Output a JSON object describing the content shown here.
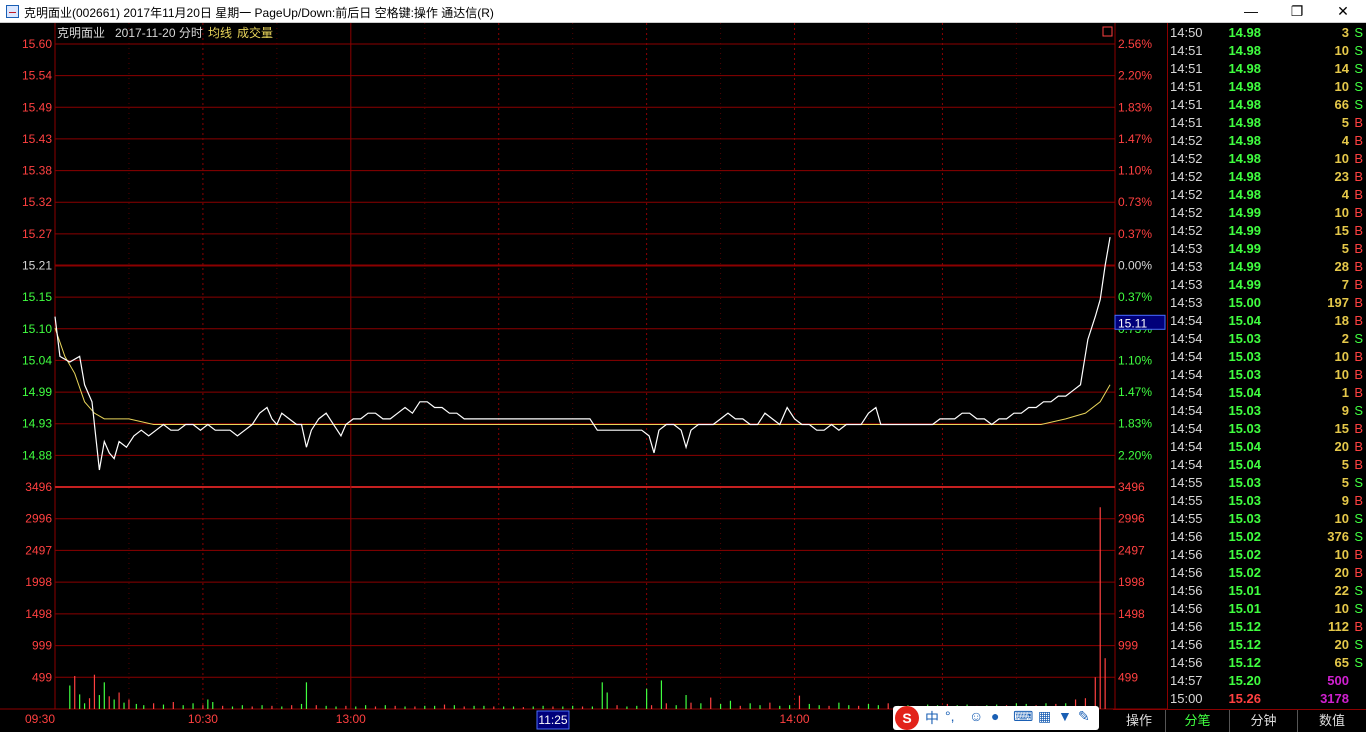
{
  "window": {
    "title": "克明面业(002661) 2017年11月20日 星期一 PageUp/Down:前后日 空格键:操作 通达信(R)",
    "minimize": "—",
    "restore": "❐",
    "close": "✕"
  },
  "chart_header": {
    "name": "克明面业",
    "date_mode": "2017-11-20 分时",
    "avg_label": "均线",
    "vol_label": "成交量",
    "corner_icon": "square-icon"
  },
  "cursor_price": "15.11",
  "cursor_time": "11:25",
  "colors": {
    "up": "#ff4040",
    "down": "#40ff40",
    "grid": "#8b0000",
    "price": "#ffffff",
    "avg": "#e8d45a",
    "volume_b": "#ff4040",
    "volume_s": "#40ff40"
  },
  "chart_data": {
    "type": "line",
    "title": "",
    "prev_close": 15.21,
    "price_axis": [
      "15.60",
      "15.54",
      "15.49",
      "15.43",
      "15.38",
      "15.32",
      "15.27",
      "15.21",
      "15.15",
      "15.10",
      "15.04",
      "14.99",
      "14.93",
      "14.88"
    ],
    "pct_axis": [
      "2.56%",
      "2.20%",
      "1.83%",
      "1.47%",
      "1.10%",
      "0.73%",
      "0.37%",
      "0.00%",
      "0.37%",
      "0.73%",
      "1.10%",
      "1.47%",
      "1.83%",
      "2.20%"
    ],
    "volume_axis": [
      "3496",
      "2996",
      "2497",
      "1998",
      "1498",
      "999",
      "499"
    ],
    "time_axis": [
      "09:30",
      "10:30",
      "13:00",
      "14:00"
    ],
    "ylim": [
      14.82,
      15.6
    ],
    "price_series": [
      [
        0,
        15.12
      ],
      [
        2,
        15.05
      ],
      [
        6,
        15.04
      ],
      [
        10,
        15.05
      ],
      [
        12,
        15.0
      ],
      [
        15,
        14.97
      ],
      [
        18,
        14.85
      ],
      [
        20,
        14.9
      ],
      [
        22,
        14.88
      ],
      [
        24,
        14.87
      ],
      [
        26,
        14.9
      ],
      [
        29,
        14.89
      ],
      [
        32,
        14.91
      ],
      [
        35,
        14.92
      ],
      [
        38,
        14.91
      ],
      [
        41,
        14.92
      ],
      [
        44,
        14.93
      ],
      [
        47,
        14.92
      ],
      [
        50,
        14.92
      ],
      [
        53,
        14.93
      ],
      [
        56,
        14.93
      ],
      [
        59,
        14.92
      ],
      [
        62,
        14.93
      ],
      [
        65,
        14.92
      ],
      [
        68,
        14.92
      ],
      [
        71,
        14.92
      ],
      [
        74,
        14.91
      ],
      [
        77,
        14.92
      ],
      [
        80,
        14.93
      ],
      [
        83,
        14.95
      ],
      [
        86,
        14.96
      ],
      [
        88,
        14.94
      ],
      [
        90,
        14.93
      ],
      [
        92,
        14.95
      ],
      [
        95,
        14.94
      ],
      [
        98,
        14.93
      ],
      [
        100,
        14.93
      ],
      [
        102,
        14.89
      ],
      [
        104,
        14.92
      ],
      [
        107,
        14.94
      ],
      [
        110,
        14.95
      ],
      [
        113,
        14.93
      ],
      [
        116,
        14.91
      ],
      [
        118,
        14.93
      ],
      [
        121,
        14.94
      ],
      [
        124,
        14.94
      ],
      [
        127,
        14.95
      ],
      [
        130,
        14.95
      ],
      [
        133,
        14.94
      ],
      [
        136,
        14.94
      ],
      [
        139,
        14.95
      ],
      [
        142,
        14.96
      ],
      [
        145,
        14.95
      ],
      [
        148,
        14.97
      ],
      [
        151,
        14.97
      ],
      [
        154,
        14.96
      ],
      [
        157,
        14.96
      ],
      [
        160,
        14.95
      ],
      [
        163,
        14.95
      ],
      [
        166,
        14.94
      ],
      [
        169,
        14.94
      ],
      [
        172,
        14.94
      ],
      [
        175,
        14.94
      ],
      [
        178,
        14.94
      ],
      [
        181,
        14.94
      ],
      [
        184,
        14.94
      ],
      [
        187,
        14.94
      ],
      [
        190,
        14.94
      ],
      [
        193,
        14.94
      ],
      [
        196,
        14.94
      ],
      [
        199,
        14.94
      ],
      [
        202,
        14.94
      ],
      [
        205,
        14.94
      ],
      [
        208,
        14.94
      ],
      [
        211,
        14.94
      ],
      [
        214,
        14.94
      ],
      [
        217,
        14.94
      ],
      [
        220,
        14.92
      ],
      [
        223,
        14.92
      ],
      [
        226,
        14.92
      ],
      [
        229,
        14.92
      ],
      [
        232,
        14.92
      ],
      [
        235,
        14.92
      ],
      [
        238,
        14.92
      ],
      [
        241,
        14.91
      ],
      [
        243,
        14.88
      ],
      [
        245,
        14.92
      ],
      [
        248,
        14.93
      ],
      [
        251,
        14.93
      ],
      [
        254,
        14.92
      ],
      [
        256,
        14.89
      ],
      [
        258,
        14.92
      ],
      [
        261,
        14.93
      ],
      [
        264,
        14.93
      ],
      [
        267,
        14.93
      ],
      [
        270,
        14.94
      ],
      [
        273,
        14.95
      ],
      [
        276,
        14.94
      ],
      [
        279,
        14.94
      ],
      [
        282,
        14.93
      ],
      [
        285,
        14.93
      ],
      [
        288,
        14.95
      ],
      [
        291,
        14.94
      ],
      [
        294,
        14.93
      ],
      [
        297,
        14.96
      ],
      [
        300,
        14.94
      ],
      [
        303,
        14.93
      ],
      [
        306,
        14.93
      ],
      [
        309,
        14.92
      ],
      [
        312,
        14.92
      ],
      [
        315,
        14.93
      ],
      [
        318,
        14.92
      ],
      [
        321,
        14.93
      ],
      [
        324,
        14.93
      ],
      [
        327,
        14.93
      ],
      [
        330,
        14.95
      ],
      [
        333,
        14.96
      ],
      [
        335,
        14.93
      ],
      [
        338,
        14.93
      ],
      [
        341,
        14.93
      ],
      [
        344,
        14.93
      ],
      [
        347,
        14.93
      ],
      [
        350,
        14.93
      ],
      [
        353,
        14.93
      ],
      [
        356,
        14.93
      ],
      [
        359,
        14.94
      ],
      [
        362,
        14.94
      ],
      [
        365,
        14.94
      ],
      [
        368,
        14.95
      ],
      [
        371,
        14.95
      ],
      [
        374,
        14.94
      ],
      [
        377,
        14.94
      ],
      [
        380,
        14.93
      ],
      [
        383,
        14.94
      ],
      [
        386,
        14.94
      ],
      [
        389,
        14.95
      ],
      [
        392,
        14.95
      ],
      [
        395,
        14.96
      ],
      [
        398,
        14.96
      ],
      [
        401,
        14.97
      ],
      [
        404,
        14.97
      ],
      [
        407,
        14.98
      ],
      [
        410,
        14.98
      ],
      [
        413,
        14.99
      ],
      [
        416,
        15.0
      ],
      [
        419,
        15.08
      ],
      [
        422,
        15.12
      ],
      [
        424,
        15.15
      ],
      [
        426,
        15.21
      ],
      [
        428,
        15.26
      ]
    ],
    "avg_series": [
      [
        0,
        15.1
      ],
      [
        4,
        15.05
      ],
      [
        8,
        15.02
      ],
      [
        12,
        14.97
      ],
      [
        16,
        14.95
      ],
      [
        20,
        14.94
      ],
      [
        30,
        14.94
      ],
      [
        40,
        14.93
      ],
      [
        60,
        14.93
      ],
      [
        80,
        14.93
      ],
      [
        100,
        14.93
      ],
      [
        120,
        14.93
      ],
      [
        140,
        14.93
      ],
      [
        160,
        14.93
      ],
      [
        180,
        14.93
      ],
      [
        200,
        14.93
      ],
      [
        220,
        14.93
      ],
      [
        240,
        14.93
      ],
      [
        260,
        14.93
      ],
      [
        280,
        14.93
      ],
      [
        300,
        14.93
      ],
      [
        320,
        14.93
      ],
      [
        340,
        14.93
      ],
      [
        360,
        14.93
      ],
      [
        380,
        14.93
      ],
      [
        400,
        14.93
      ],
      [
        410,
        14.94
      ],
      [
        418,
        14.95
      ],
      [
        424,
        14.97
      ],
      [
        428,
        15.0
      ]
    ],
    "volume_series": [
      [
        6,
        370,
        "S"
      ],
      [
        8,
        520,
        "B"
      ],
      [
        10,
        230,
        "S"
      ],
      [
        12,
        90,
        "S"
      ],
      [
        14,
        170,
        "B"
      ],
      [
        16,
        540,
        "B"
      ],
      [
        18,
        220,
        "S"
      ],
      [
        20,
        420,
        "S"
      ],
      [
        22,
        200,
        "B"
      ],
      [
        24,
        150,
        "S"
      ],
      [
        26,
        260,
        "B"
      ],
      [
        28,
        100,
        "S"
      ],
      [
        30,
        150,
        "B"
      ],
      [
        33,
        80,
        "S"
      ],
      [
        36,
        60,
        "S"
      ],
      [
        40,
        90,
        "B"
      ],
      [
        44,
        70,
        "S"
      ],
      [
        48,
        110,
        "B"
      ],
      [
        52,
        60,
        "S"
      ],
      [
        56,
        90,
        "S"
      ],
      [
        60,
        60,
        "B"
      ],
      [
        62,
        150,
        "S"
      ],
      [
        64,
        110,
        "S"
      ],
      [
        68,
        50,
        "B"
      ],
      [
        72,
        40,
        "S"
      ],
      [
        76,
        60,
        "S"
      ],
      [
        80,
        40,
        "B"
      ],
      [
        84,
        60,
        "S"
      ],
      [
        88,
        50,
        "B"
      ],
      [
        92,
        40,
        "S"
      ],
      [
        96,
        60,
        "B"
      ],
      [
        100,
        80,
        "S"
      ],
      [
        102,
        420,
        "S"
      ],
      [
        106,
        60,
        "B"
      ],
      [
        110,
        50,
        "S"
      ],
      [
        114,
        40,
        "S"
      ],
      [
        118,
        50,
        "B"
      ],
      [
        122,
        40,
        "S"
      ],
      [
        126,
        60,
        "S"
      ],
      [
        130,
        40,
        "B"
      ],
      [
        134,
        60,
        "S"
      ],
      [
        138,
        50,
        "B"
      ],
      [
        142,
        40,
        "S"
      ],
      [
        146,
        40,
        "B"
      ],
      [
        150,
        50,
        "S"
      ],
      [
        154,
        50,
        "S"
      ],
      [
        158,
        70,
        "B"
      ],
      [
        162,
        60,
        "S"
      ],
      [
        166,
        40,
        "B"
      ],
      [
        170,
        50,
        "S"
      ],
      [
        174,
        50,
        "S"
      ],
      [
        178,
        40,
        "B"
      ],
      [
        182,
        40,
        "S"
      ],
      [
        186,
        40,
        "S"
      ],
      [
        190,
        30,
        "B"
      ],
      [
        194,
        40,
        "S"
      ],
      [
        198,
        50,
        "S"
      ],
      [
        202,
        40,
        "B"
      ],
      [
        206,
        40,
        "S"
      ],
      [
        210,
        50,
        "S"
      ],
      [
        214,
        40,
        "B"
      ],
      [
        218,
        40,
        "S"
      ],
      [
        222,
        420,
        "S"
      ],
      [
        224,
        260,
        "S"
      ],
      [
        228,
        60,
        "B"
      ],
      [
        232,
        40,
        "S"
      ],
      [
        236,
        50,
        "S"
      ],
      [
        240,
        320,
        "S"
      ],
      [
        242,
        60,
        "B"
      ],
      [
        246,
        450,
        "S"
      ],
      [
        248,
        90,
        "B"
      ],
      [
        252,
        60,
        "S"
      ],
      [
        256,
        220,
        "S"
      ],
      [
        258,
        100,
        "B"
      ],
      [
        262,
        90,
        "S"
      ],
      [
        266,
        180,
        "B"
      ],
      [
        270,
        80,
        "S"
      ],
      [
        274,
        130,
        "S"
      ],
      [
        278,
        50,
        "B"
      ],
      [
        282,
        90,
        "S"
      ],
      [
        286,
        60,
        "S"
      ],
      [
        290,
        100,
        "B"
      ],
      [
        294,
        50,
        "S"
      ],
      [
        298,
        60,
        "S"
      ],
      [
        302,
        210,
        "B"
      ],
      [
        306,
        80,
        "S"
      ],
      [
        310,
        60,
        "S"
      ],
      [
        314,
        50,
        "B"
      ],
      [
        318,
        100,
        "S"
      ],
      [
        322,
        60,
        "S"
      ],
      [
        326,
        50,
        "B"
      ],
      [
        330,
        80,
        "S"
      ],
      [
        334,
        60,
        "S"
      ],
      [
        338,
        90,
        "B"
      ],
      [
        342,
        50,
        "S"
      ],
      [
        346,
        60,
        "S"
      ],
      [
        350,
        40,
        "B"
      ],
      [
        354,
        70,
        "S"
      ],
      [
        358,
        60,
        "S"
      ],
      [
        362,
        80,
        "B"
      ],
      [
        366,
        60,
        "S"
      ],
      [
        370,
        70,
        "S"
      ],
      [
        374,
        50,
        "B"
      ],
      [
        378,
        60,
        "S"
      ],
      [
        382,
        70,
        "S"
      ],
      [
        386,
        60,
        "B"
      ],
      [
        390,
        90,
        "S"
      ],
      [
        394,
        80,
        "S"
      ],
      [
        398,
        60,
        "B"
      ],
      [
        402,
        90,
        "S"
      ],
      [
        406,
        80,
        "B"
      ],
      [
        410,
        90,
        "S"
      ],
      [
        414,
        150,
        "B"
      ],
      [
        418,
        170,
        "B"
      ],
      [
        422,
        500,
        "B"
      ],
      [
        424,
        3178,
        "B"
      ],
      [
        426,
        800,
        "B"
      ]
    ],
    "volume_max": 3496
  },
  "ticks": [
    {
      "time": "14:50",
      "price": "14.98",
      "vol": "3",
      "bs": "S"
    },
    {
      "time": "14:51",
      "price": "14.98",
      "vol": "10",
      "bs": "S"
    },
    {
      "time": "14:51",
      "price": "14.98",
      "vol": "14",
      "bs": "S"
    },
    {
      "time": "14:51",
      "price": "14.98",
      "vol": "10",
      "bs": "S"
    },
    {
      "time": "14:51",
      "price": "14.98",
      "vol": "66",
      "bs": "S"
    },
    {
      "time": "14:51",
      "price": "14.98",
      "vol": "5",
      "bs": "B"
    },
    {
      "time": "14:52",
      "price": "14.98",
      "vol": "4",
      "bs": "B"
    },
    {
      "time": "14:52",
      "price": "14.98",
      "vol": "10",
      "bs": "B"
    },
    {
      "time": "14:52",
      "price": "14.98",
      "vol": "23",
      "bs": "B"
    },
    {
      "time": "14:52",
      "price": "14.98",
      "vol": "4",
      "bs": "B"
    },
    {
      "time": "14:52",
      "price": "14.99",
      "vol": "10",
      "bs": "B"
    },
    {
      "time": "14:52",
      "price": "14.99",
      "vol": "15",
      "bs": "B"
    },
    {
      "time": "14:53",
      "price": "14.99",
      "vol": "5",
      "bs": "B"
    },
    {
      "time": "14:53",
      "price": "14.99",
      "vol": "28",
      "bs": "B"
    },
    {
      "time": "14:53",
      "price": "14.99",
      "vol": "7",
      "bs": "B"
    },
    {
      "time": "14:53",
      "price": "15.00",
      "vol": "197",
      "bs": "B"
    },
    {
      "time": "14:54",
      "price": "15.04",
      "vol": "18",
      "bs": "B"
    },
    {
      "time": "14:54",
      "price": "15.03",
      "vol": "2",
      "bs": "S"
    },
    {
      "time": "14:54",
      "price": "15.03",
      "vol": "10",
      "bs": "B"
    },
    {
      "time": "14:54",
      "price": "15.03",
      "vol": "10",
      "bs": "B"
    },
    {
      "time": "14:54",
      "price": "15.04",
      "vol": "1",
      "bs": "B"
    },
    {
      "time": "14:54",
      "price": "15.03",
      "vol": "9",
      "bs": "S"
    },
    {
      "time": "14:54",
      "price": "15.03",
      "vol": "15",
      "bs": "B"
    },
    {
      "time": "14:54",
      "price": "15.04",
      "vol": "20",
      "bs": "B"
    },
    {
      "time": "14:54",
      "price": "15.04",
      "vol": "5",
      "bs": "B"
    },
    {
      "time": "14:55",
      "price": "15.03",
      "vol": "5",
      "bs": "S"
    },
    {
      "time": "14:55",
      "price": "15.03",
      "vol": "9",
      "bs": "B"
    },
    {
      "time": "14:55",
      "price": "15.03",
      "vol": "10",
      "bs": "S"
    },
    {
      "time": "14:56",
      "price": "15.02",
      "vol": "376",
      "bs": "S"
    },
    {
      "time": "14:56",
      "price": "15.02",
      "vol": "10",
      "bs": "B"
    },
    {
      "time": "14:56",
      "price": "15.02",
      "vol": "20",
      "bs": "B"
    },
    {
      "time": "14:56",
      "price": "15.01",
      "vol": "22",
      "bs": "S"
    },
    {
      "time": "14:56",
      "price": "15.01",
      "vol": "10",
      "bs": "S"
    },
    {
      "time": "14:56",
      "price": "15.12",
      "vol": "112",
      "bs": "B"
    },
    {
      "time": "14:56",
      "price": "15.12",
      "vol": "20",
      "bs": "S"
    },
    {
      "time": "14:56",
      "price": "15.12",
      "vol": "65",
      "bs": "S"
    },
    {
      "time": "14:57",
      "price": "15.20",
      "vol": "500",
      "bs": ""
    },
    {
      "time": "15:00",
      "price": "15.26",
      "vol": "3178",
      "bs": ""
    }
  ],
  "tabs": [
    "操作",
    "分笔",
    "分钟",
    "数值"
  ],
  "ime": {
    "logo": "S",
    "lang": "中",
    "punct": "°,",
    "emoji_icon": "smile-icon",
    "mic_icon": "mic-icon",
    "keyboard_icon": "keyboard-icon",
    "skin_icon": "shirt-icon",
    "tools_icon": "wrench-icon"
  }
}
